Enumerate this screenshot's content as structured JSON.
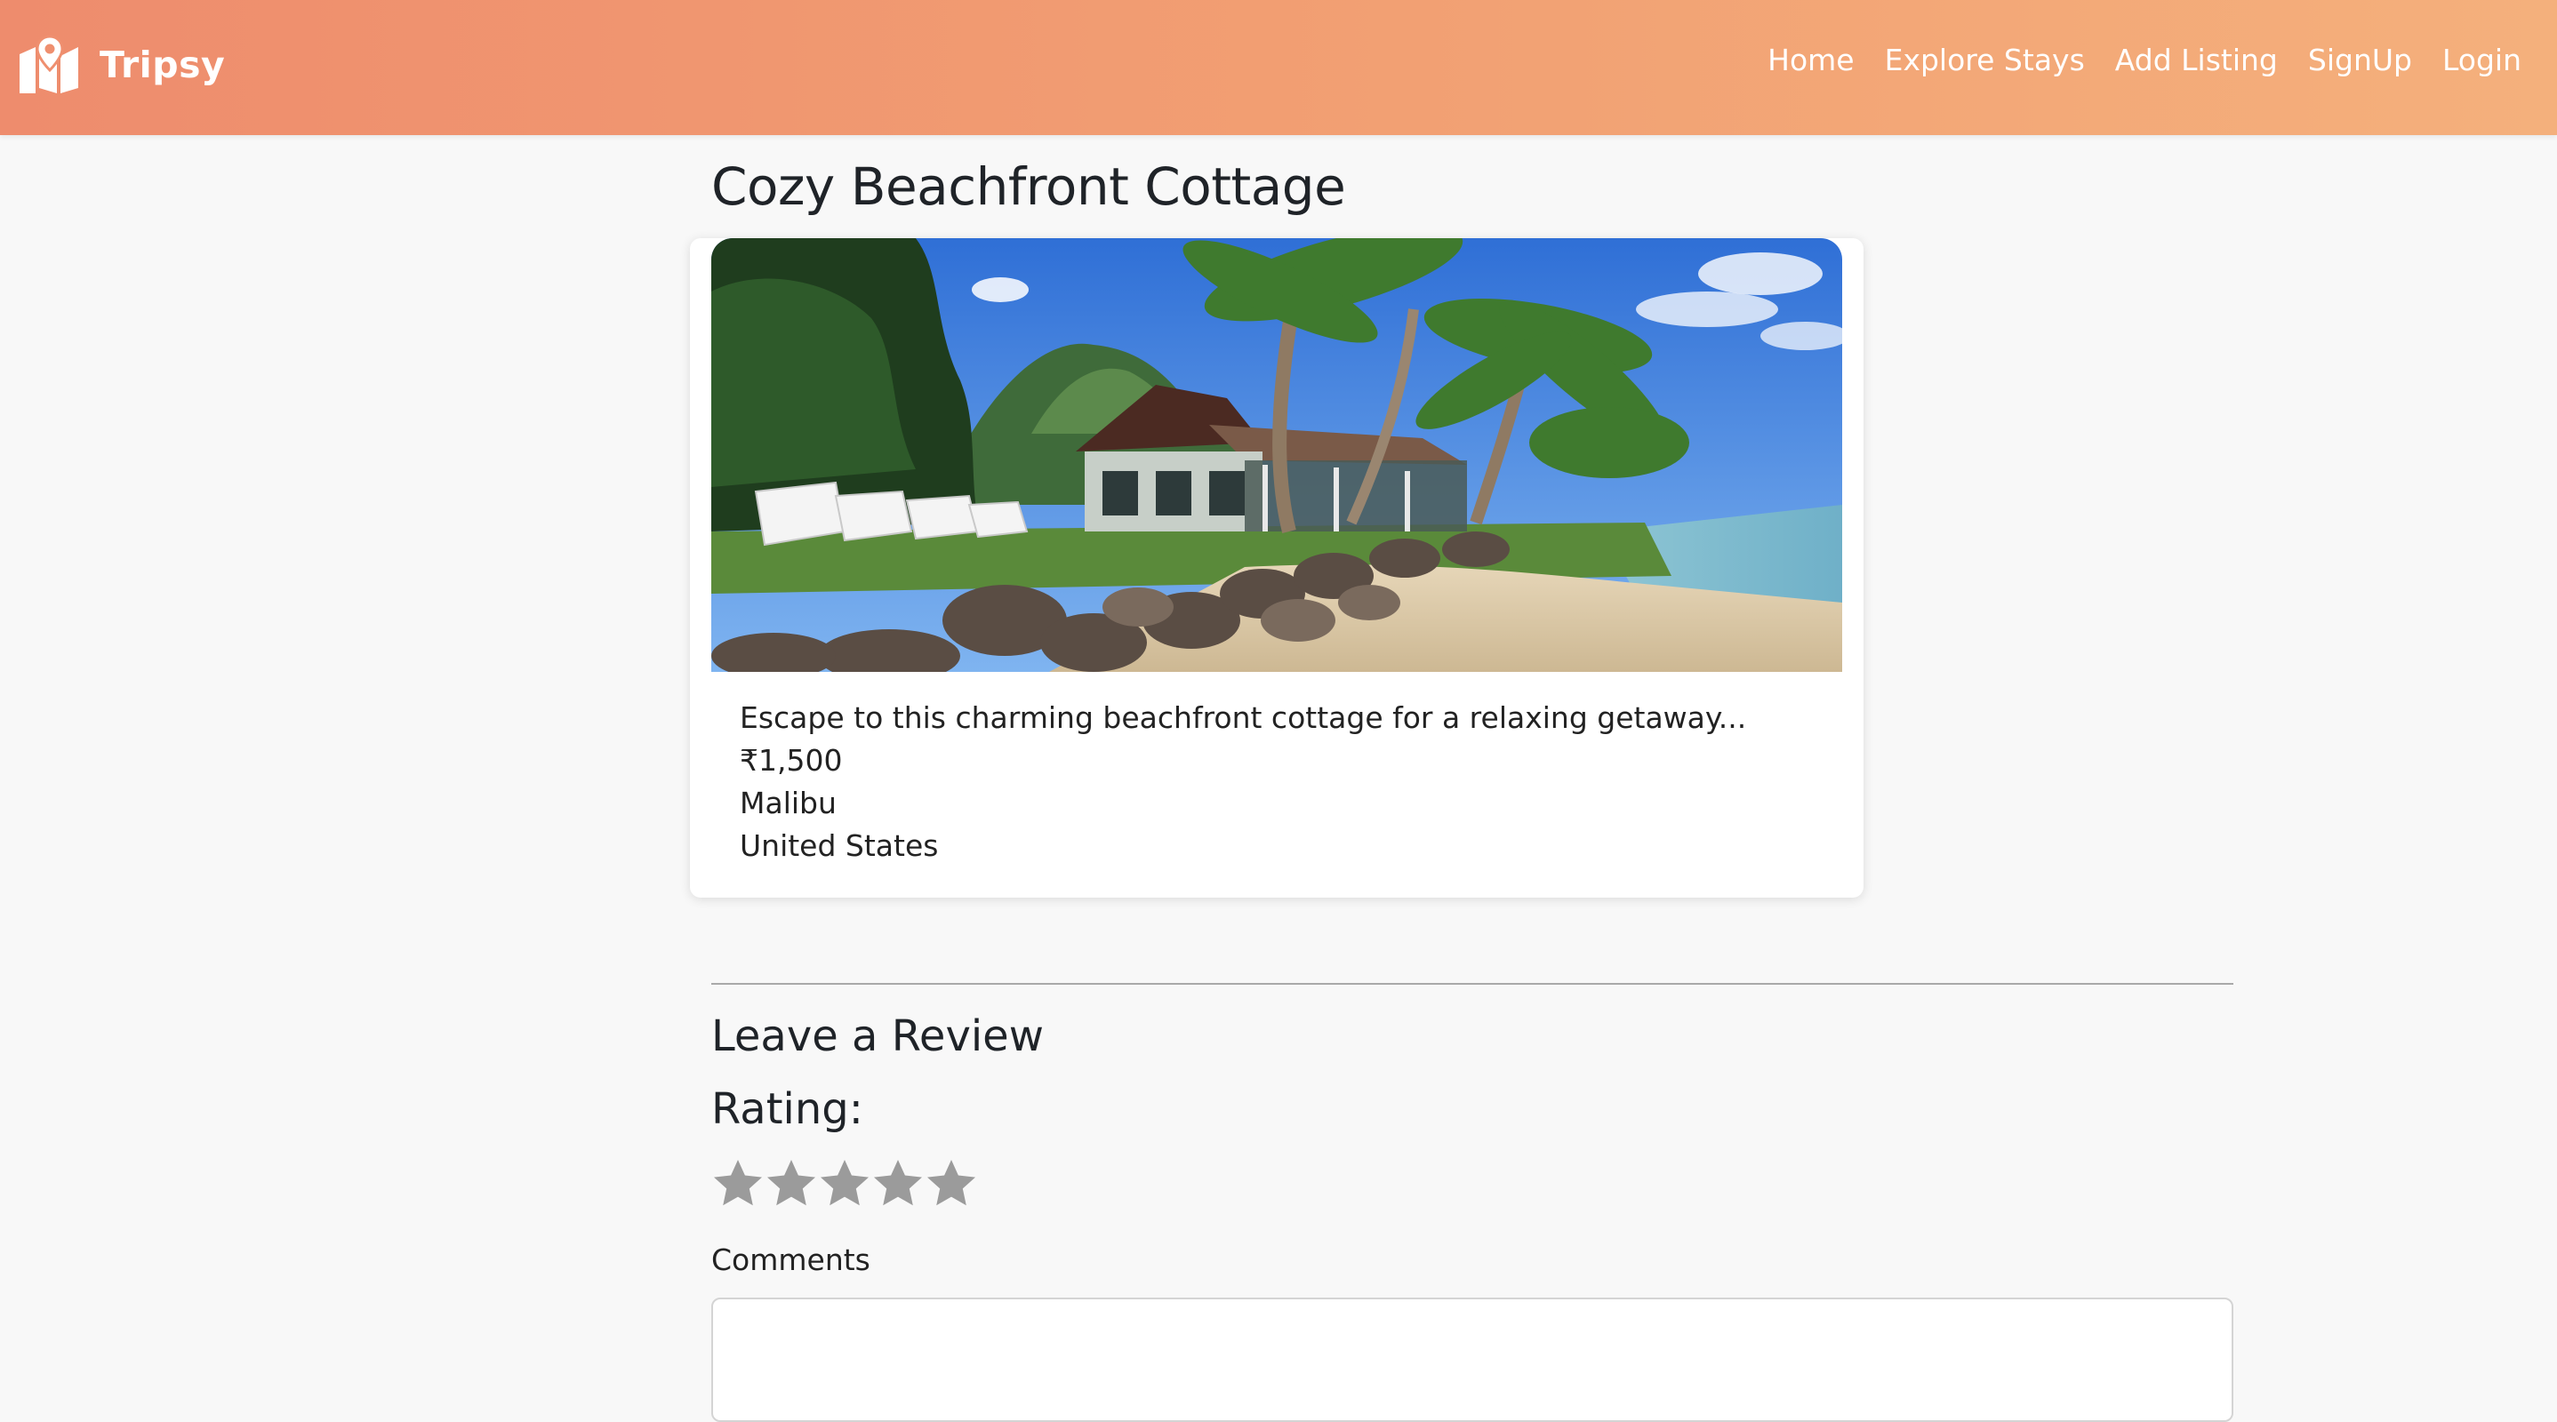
{
  "brand": {
    "name": "Tripsy",
    "logo_icon": "map-pin-icon",
    "header_gradient": [
      "#ee8c6d",
      "#f4b07c"
    ]
  },
  "nav": {
    "items": [
      {
        "label": "Home"
      },
      {
        "label": "Explore Stays"
      },
      {
        "label": "Add Listing"
      },
      {
        "label": "SignUp"
      },
      {
        "label": "Login"
      }
    ]
  },
  "listing": {
    "title": "Cozy Beachfront Cottage",
    "description": "Escape to this charming beachfront cottage for a relaxing getaway...",
    "price": "₹1,500",
    "location": "Malibu",
    "country": "United States"
  },
  "review": {
    "heading": "Leave a Review",
    "rating_label": "Rating:",
    "rating_value": 0,
    "rating_max": 5,
    "star_color": "#9b9b9b",
    "comments_label": "Comments",
    "comments_value": ""
  }
}
